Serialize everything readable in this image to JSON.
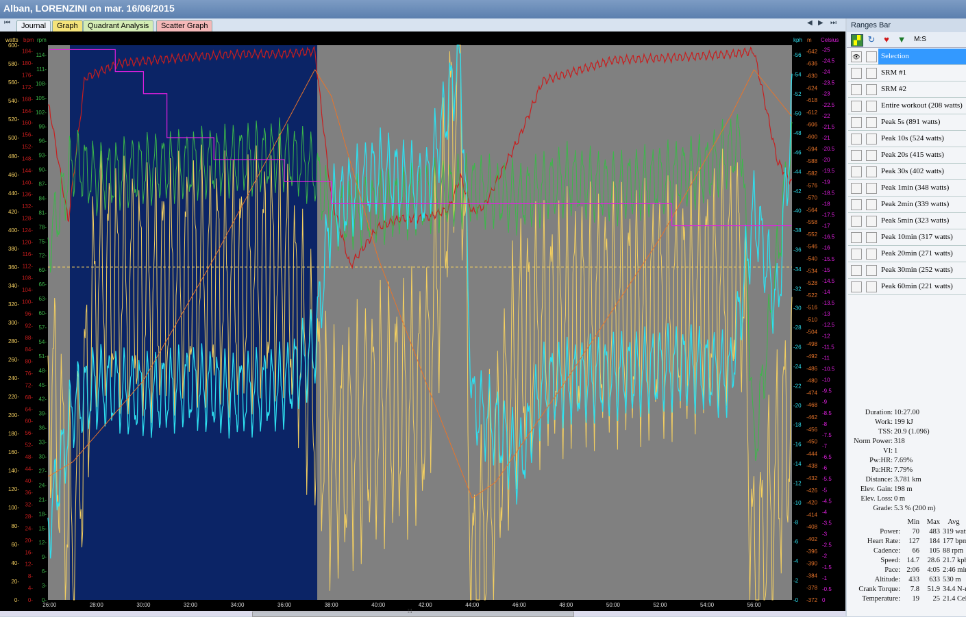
{
  "window": {
    "title": "Alban, LORENZINI on mar. 16/06/2015"
  },
  "tabs": [
    {
      "label": "Journal",
      "color": "#e6ecf4",
      "active": true
    },
    {
      "label": "Graph",
      "color": "#f4e37a"
    },
    {
      "label": "Quadrant Analysis",
      "color": "#d4ecb4"
    },
    {
      "label": "Scatter Graph",
      "color": "#f4b8b8"
    }
  ],
  "nav": {
    "first": "⏮",
    "prev": "◀",
    "next": "▶",
    "last": "⏭"
  },
  "axes": {
    "units": {
      "watts": "watts",
      "bpm": "bpm",
      "rpm": "rpm",
      "kph": "kph",
      "m": "m",
      "celsius": "Celsius"
    },
    "watts_ticks": [
      "0-",
      "20-",
      "40-",
      "60-",
      "80-",
      "100-",
      "120-",
      "140-",
      "160-",
      "180-",
      "200-",
      "220-",
      "240-",
      "260-",
      "280-",
      "300-",
      "320-",
      "340-",
      "360-",
      "380-",
      "400-",
      "420-",
      "440-",
      "460-",
      "480-",
      "500-",
      "520-",
      "540-",
      "560-",
      "580-",
      "600-"
    ],
    "bpm_ticks": [
      "0-",
      "4-",
      "8-",
      "12-",
      "16-",
      "20-",
      "24-",
      "28-",
      "32-",
      "36-",
      "40-",
      "44-",
      "48-",
      "52-",
      "56-",
      "60-",
      "64-",
      "68-",
      "72-",
      "76-",
      "80-",
      "84-",
      "88-",
      "92-",
      "96-",
      "100-",
      "104-",
      "108-",
      "112-",
      "116-",
      "120-",
      "124-",
      "128-",
      "132-",
      "136-",
      "140-",
      "144-",
      "148-",
      "152-",
      "156-",
      "160-",
      "164-",
      "168-",
      "172-",
      "176-",
      "180-",
      "184-"
    ],
    "rpm_ticks": [
      "0-",
      "3-",
      "6-",
      "9-",
      "12-",
      "15-",
      "18-",
      "21-",
      "24-",
      "27-",
      "30-",
      "33-",
      "36-",
      "39-",
      "42-",
      "45-",
      "48-",
      "51-",
      "54-",
      "57-",
      "60-",
      "63-",
      "66-",
      "69-",
      "72-",
      "75-",
      "78-",
      "81-",
      "84-",
      "87-",
      "90-",
      "93-",
      "96-",
      "99-",
      "102-",
      "105-",
      "108-",
      "111-",
      "114-"
    ],
    "kph_ticks": [
      "-0",
      "-2",
      "-4",
      "-6",
      "-8",
      "-10",
      "-12",
      "-14",
      "-16",
      "-18",
      "-20",
      "-22",
      "-24",
      "-26",
      "-28",
      "-30",
      "-32",
      "-34",
      "-36",
      "-38",
      "-40",
      "-42",
      "-44",
      "-46",
      "-48",
      "-50",
      "-52",
      "-54",
      "-56"
    ],
    "m_ticks": [
      "-372",
      "-378",
      "-384",
      "-390",
      "-396",
      "-402",
      "-408",
      "-414",
      "-420",
      "-426",
      "-432",
      "-438",
      "-444",
      "-450",
      "-456",
      "-462",
      "-468",
      "-474",
      "-480",
      "-486",
      "-492",
      "-498",
      "-504",
      "-510",
      "-516",
      "-522",
      "-528",
      "-534",
      "-540",
      "-546",
      "-552",
      "-558",
      "-564",
      "-570",
      "-576",
      "-582",
      "-588",
      "-594",
      "-600",
      "-606",
      "-612",
      "-618",
      "-624",
      "-630",
      "-636",
      "-642"
    ],
    "celsius_ticks": [
      "0",
      "-0.5",
      "-1",
      "-1.5",
      "-2",
      "-2.5",
      "-3",
      "-3.5",
      "-4",
      "-4.5",
      "-5",
      "-5.5",
      "-6",
      "-6.5",
      "-7",
      "-7.5",
      "-8",
      "-8.5",
      "-9",
      "-9.5",
      "-10",
      "-10.5",
      "-11",
      "-11.5",
      "-12",
      "-12.5",
      "-13",
      "-13.5",
      "-14",
      "-14.5",
      "-15",
      "-15.5",
      "-16",
      "-16.5",
      "-17",
      "-17.5",
      "-18",
      "-18.5",
      "-19",
      "-19.5",
      "-20",
      "-20.5",
      "-21",
      "-21.5",
      "-22",
      "-22.5",
      "-23",
      "-23.5",
      "-24",
      "-24.5",
      "-25"
    ],
    "time_ticks": [
      "26:00",
      "28:00",
      "30:00",
      "32:00",
      "34:00",
      "36:00",
      "38:00",
      "40:00",
      "42:00",
      "44:00",
      "46:00",
      "48:00",
      "50:00",
      "52:00",
      "54:00",
      "56:00"
    ]
  },
  "chart_data": {
    "type": "line",
    "x_range": [
      "25:56",
      "57:37"
    ],
    "selection_range": [
      "26:52",
      "37:24"
    ],
    "colors": {
      "power": "#f5d060",
      "heart_rate": "#c81e1e",
      "cadence": "#3cb84a",
      "speed": "#2ee0f0",
      "altitude": "#e8742a",
      "temperature": "#e020e0",
      "selection": "#0b2466",
      "background": "#808080",
      "threshold": "#f5d060"
    },
    "threshold_watts": 360,
    "series": [
      {
        "name": "Power",
        "unit": "watts",
        "description_points": [
          [
            26,
            250
          ],
          [
            27,
            60
          ],
          [
            28,
            350
          ],
          [
            30,
            330
          ],
          [
            32,
            350
          ],
          [
            34,
            340
          ],
          [
            36,
            360
          ],
          [
            38,
            150
          ],
          [
            40,
            200
          ],
          [
            42,
            220
          ],
          [
            43.5,
            600
          ],
          [
            44,
            0
          ],
          [
            46,
            280
          ],
          [
            48,
            300
          ],
          [
            50,
            310
          ],
          [
            52,
            310
          ],
          [
            54,
            330
          ],
          [
            55.5,
            360
          ],
          [
            56,
            0
          ],
          [
            57.5,
            200
          ]
        ]
      },
      {
        "name": "Heart Rate",
        "unit": "bpm",
        "points": [
          [
            26,
            165
          ],
          [
            26.8,
            127
          ],
          [
            27.5,
            175
          ],
          [
            29,
            180
          ],
          [
            32,
            182
          ],
          [
            34,
            183
          ],
          [
            36,
            183
          ],
          [
            37.3,
            184
          ],
          [
            38,
            135
          ],
          [
            38.8,
            112
          ],
          [
            40,
            125
          ],
          [
            41,
            128
          ],
          [
            42,
            128
          ],
          [
            43,
            131
          ],
          [
            43.5,
            142
          ],
          [
            44,
            130
          ],
          [
            44.5,
            132
          ],
          [
            46,
            155
          ],
          [
            47,
            174
          ],
          [
            50,
            181
          ],
          [
            53,
            182
          ],
          [
            55,
            183
          ],
          [
            56,
            184
          ],
          [
            57,
            147
          ],
          [
            57.6,
            140
          ]
        ]
      },
      {
        "name": "Cadence",
        "unit": "rpm",
        "points": [
          [
            26,
            75
          ],
          [
            27,
            92
          ],
          [
            28,
            88
          ],
          [
            30,
            90
          ],
          [
            32,
            91
          ],
          [
            34,
            92
          ],
          [
            36,
            93
          ],
          [
            37.3,
            90
          ],
          [
            38,
            80
          ],
          [
            40,
            82
          ],
          [
            42,
            84
          ],
          [
            44,
            86
          ],
          [
            46,
            84
          ],
          [
            48,
            88
          ],
          [
            50,
            86
          ],
          [
            52,
            88
          ],
          [
            54,
            90
          ],
          [
            55.5,
            96
          ],
          [
            56,
            30
          ],
          [
            57.5,
            93
          ]
        ]
      },
      {
        "name": "Speed",
        "unit": "kph",
        "points": [
          [
            26,
            8
          ],
          [
            27,
            20
          ],
          [
            28,
            22
          ],
          [
            30,
            21
          ],
          [
            32,
            22
          ],
          [
            34,
            21
          ],
          [
            36,
            22
          ],
          [
            37.3,
            26
          ],
          [
            38,
            40
          ],
          [
            40,
            44
          ],
          [
            42,
            42
          ],
          [
            43.5,
            56
          ],
          [
            44,
            20
          ],
          [
            45,
            18
          ],
          [
            46,
            14
          ],
          [
            47,
            22
          ],
          [
            50,
            23
          ],
          [
            53,
            24
          ],
          [
            55,
            23
          ],
          [
            56,
            40
          ],
          [
            57,
            30
          ],
          [
            57.6,
            50
          ]
        ]
      },
      {
        "name": "Altitude",
        "unit": "m",
        "points": [
          [
            26,
            433
          ],
          [
            27,
            440
          ],
          [
            30,
            480
          ],
          [
            33,
            540
          ],
          [
            37.3,
            633
          ],
          [
            38,
            620
          ],
          [
            40,
            540
          ],
          [
            42,
            480
          ],
          [
            44,
            422
          ],
          [
            45,
            430
          ],
          [
            48,
            480
          ],
          [
            52,
            550
          ],
          [
            55,
            610
          ],
          [
            56,
            633
          ],
          [
            57.6,
            610
          ]
        ]
      },
      {
        "name": "Temperature",
        "unit": "Celsius",
        "points": [
          [
            26,
            25
          ],
          [
            27.8,
            25
          ],
          [
            28.8,
            24
          ],
          [
            30,
            23
          ],
          [
            31,
            21
          ],
          [
            33,
            20
          ],
          [
            36,
            19
          ],
          [
            37.3,
            19
          ],
          [
            38,
            18
          ],
          [
            42,
            18
          ],
          [
            48,
            18
          ],
          [
            52,
            18
          ],
          [
            52.5,
            17
          ],
          [
            57.6,
            17
          ]
        ]
      }
    ]
  },
  "ranges_bar": {
    "title": "Ranges Bar",
    "tools": {
      "chart": "chart-icon",
      "refresh": "refresh-icon",
      "heart": "heart-icon",
      "gem": "gem-icon",
      "ms_label": "M:S"
    },
    "items": [
      {
        "label": "Selection",
        "selected": true,
        "eye": "👁"
      },
      {
        "label": "SRM #1"
      },
      {
        "label": "SRM #2"
      },
      {
        "label": "Entire workout (208 watts)"
      },
      {
        "label": "Peak 5s (891 watts)"
      },
      {
        "label": "Peak 10s (524 watts)"
      },
      {
        "label": "Peak 20s (415 watts)"
      },
      {
        "label": "Peak 30s (402 watts)"
      },
      {
        "label": "Peak 1min (348 watts)"
      },
      {
        "label": "Peak 2min (339 watts)"
      },
      {
        "label": "Peak 5min (323 watts)"
      },
      {
        "label": "Peak 10min (317 watts)"
      },
      {
        "label": "Peak 20min (271 watts)"
      },
      {
        "label": "Peak 30min (252 watts)"
      },
      {
        "label": "Peak 60min (221 watts)"
      }
    ]
  },
  "summary": [
    {
      "label": "Duration:",
      "value": "10:27.00"
    },
    {
      "label": "Work:",
      "value": "199 kJ"
    },
    {
      "label": "TSS:",
      "value": "20.9 (1.096)"
    },
    {
      "label": "Norm Power:",
      "value": "318"
    },
    {
      "label": "VI:",
      "value": "1"
    },
    {
      "label": "Pw:HR:",
      "value": "7.69%"
    },
    {
      "label": "Pa:HR:",
      "value": "7.79%"
    },
    {
      "label": "Distance:",
      "value": "3.781 km"
    },
    {
      "label": "Elev. Gain:",
      "value": "198 m"
    },
    {
      "label": "Elev. Loss:",
      "value": "0 m"
    },
    {
      "label": "Grade:",
      "value": "5.3 % (200 m)"
    }
  ],
  "stats_table": {
    "headers": [
      "Min",
      "Max",
      "Avg"
    ],
    "rows": [
      {
        "label": "Power:",
        "min": "70",
        "max": "483",
        "avg": "319 watts"
      },
      {
        "label": "Heart Rate:",
        "min": "127",
        "max": "184",
        "avg": "177 bpm"
      },
      {
        "label": "Cadence:",
        "min": "66",
        "max": "105",
        "avg": "88 rpm"
      },
      {
        "label": "Speed:",
        "min": "14.7",
        "max": "28.6",
        "avg": "21.7 kph"
      },
      {
        "label": "Pace:",
        "min": "2:06",
        "max": "4:05",
        "avg": "2:46 min/km"
      },
      {
        "label": "Altitude:",
        "min": "433",
        "max": "633",
        "avg": "530 m"
      },
      {
        "label": "Crank Torque:",
        "min": "7.8",
        "max": "51.9",
        "avg": "34.4 N-m"
      },
      {
        "label": "Temperature:",
        "min": "19",
        "max": "25",
        "avg": "21.4 Celsius"
      }
    ]
  },
  "scrollbar": {
    "grip": "⁞⁞⁞"
  }
}
